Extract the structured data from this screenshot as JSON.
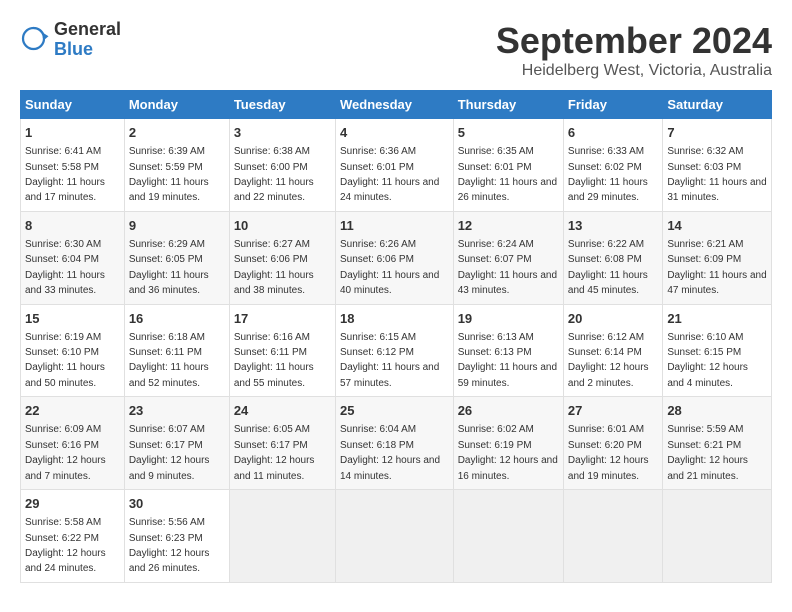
{
  "logo": {
    "general": "General",
    "blue": "Blue"
  },
  "title": "September 2024",
  "location": "Heidelberg West, Victoria, Australia",
  "days_of_week": [
    "Sunday",
    "Monday",
    "Tuesday",
    "Wednesday",
    "Thursday",
    "Friday",
    "Saturday"
  ],
  "weeks": [
    [
      {
        "day": "1",
        "sunrise": "6:41 AM",
        "sunset": "5:58 PM",
        "daylight": "11 hours and 17 minutes."
      },
      {
        "day": "2",
        "sunrise": "6:39 AM",
        "sunset": "5:59 PM",
        "daylight": "11 hours and 19 minutes."
      },
      {
        "day": "3",
        "sunrise": "6:38 AM",
        "sunset": "6:00 PM",
        "daylight": "11 hours and 22 minutes."
      },
      {
        "day": "4",
        "sunrise": "6:36 AM",
        "sunset": "6:01 PM",
        "daylight": "11 hours and 24 minutes."
      },
      {
        "day": "5",
        "sunrise": "6:35 AM",
        "sunset": "6:01 PM",
        "daylight": "11 hours and 26 minutes."
      },
      {
        "day": "6",
        "sunrise": "6:33 AM",
        "sunset": "6:02 PM",
        "daylight": "11 hours and 29 minutes."
      },
      {
        "day": "7",
        "sunrise": "6:32 AM",
        "sunset": "6:03 PM",
        "daylight": "11 hours and 31 minutes."
      }
    ],
    [
      {
        "day": "8",
        "sunrise": "6:30 AM",
        "sunset": "6:04 PM",
        "daylight": "11 hours and 33 minutes."
      },
      {
        "day": "9",
        "sunrise": "6:29 AM",
        "sunset": "6:05 PM",
        "daylight": "11 hours and 36 minutes."
      },
      {
        "day": "10",
        "sunrise": "6:27 AM",
        "sunset": "6:06 PM",
        "daylight": "11 hours and 38 minutes."
      },
      {
        "day": "11",
        "sunrise": "6:26 AM",
        "sunset": "6:06 PM",
        "daylight": "11 hours and 40 minutes."
      },
      {
        "day": "12",
        "sunrise": "6:24 AM",
        "sunset": "6:07 PM",
        "daylight": "11 hours and 43 minutes."
      },
      {
        "day": "13",
        "sunrise": "6:22 AM",
        "sunset": "6:08 PM",
        "daylight": "11 hours and 45 minutes."
      },
      {
        "day": "14",
        "sunrise": "6:21 AM",
        "sunset": "6:09 PM",
        "daylight": "11 hours and 47 minutes."
      }
    ],
    [
      {
        "day": "15",
        "sunrise": "6:19 AM",
        "sunset": "6:10 PM",
        "daylight": "11 hours and 50 minutes."
      },
      {
        "day": "16",
        "sunrise": "6:18 AM",
        "sunset": "6:11 PM",
        "daylight": "11 hours and 52 minutes."
      },
      {
        "day": "17",
        "sunrise": "6:16 AM",
        "sunset": "6:11 PM",
        "daylight": "11 hours and 55 minutes."
      },
      {
        "day": "18",
        "sunrise": "6:15 AM",
        "sunset": "6:12 PM",
        "daylight": "11 hours and 57 minutes."
      },
      {
        "day": "19",
        "sunrise": "6:13 AM",
        "sunset": "6:13 PM",
        "daylight": "11 hours and 59 minutes."
      },
      {
        "day": "20",
        "sunrise": "6:12 AM",
        "sunset": "6:14 PM",
        "daylight": "12 hours and 2 minutes."
      },
      {
        "day": "21",
        "sunrise": "6:10 AM",
        "sunset": "6:15 PM",
        "daylight": "12 hours and 4 minutes."
      }
    ],
    [
      {
        "day": "22",
        "sunrise": "6:09 AM",
        "sunset": "6:16 PM",
        "daylight": "12 hours and 7 minutes."
      },
      {
        "day": "23",
        "sunrise": "6:07 AM",
        "sunset": "6:17 PM",
        "daylight": "12 hours and 9 minutes."
      },
      {
        "day": "24",
        "sunrise": "6:05 AM",
        "sunset": "6:17 PM",
        "daylight": "12 hours and 11 minutes."
      },
      {
        "day": "25",
        "sunrise": "6:04 AM",
        "sunset": "6:18 PM",
        "daylight": "12 hours and 14 minutes."
      },
      {
        "day": "26",
        "sunrise": "6:02 AM",
        "sunset": "6:19 PM",
        "daylight": "12 hours and 16 minutes."
      },
      {
        "day": "27",
        "sunrise": "6:01 AM",
        "sunset": "6:20 PM",
        "daylight": "12 hours and 19 minutes."
      },
      {
        "day": "28",
        "sunrise": "5:59 AM",
        "sunset": "6:21 PM",
        "daylight": "12 hours and 21 minutes."
      }
    ],
    [
      {
        "day": "29",
        "sunrise": "5:58 AM",
        "sunset": "6:22 PM",
        "daylight": "12 hours and 24 minutes."
      },
      {
        "day": "30",
        "sunrise": "5:56 AM",
        "sunset": "6:23 PM",
        "daylight": "12 hours and 26 minutes."
      },
      null,
      null,
      null,
      null,
      null
    ]
  ]
}
